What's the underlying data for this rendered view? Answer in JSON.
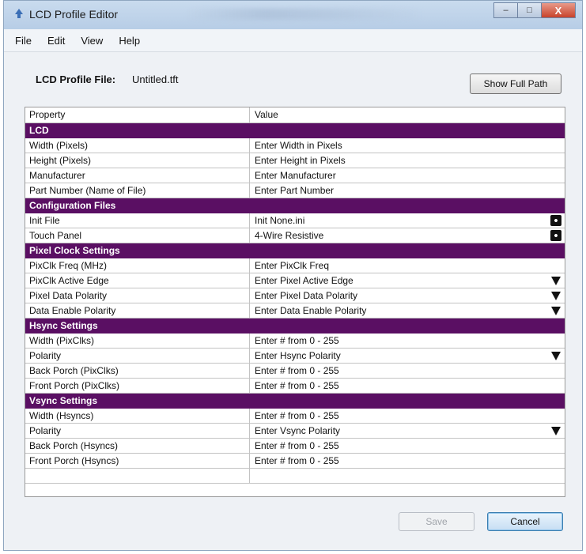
{
  "window": {
    "title": "LCD Profile Editor",
    "controls": {
      "minimize": "–",
      "maximize": "□",
      "close": "X"
    }
  },
  "menu": [
    "File",
    "Edit",
    "View",
    "Help"
  ],
  "profile": {
    "label": "LCD Profile File:",
    "value": "Untitled.tft",
    "full_path_button": "Show Full Path"
  },
  "grid": {
    "columns": [
      "Property",
      "Value"
    ],
    "rows": [
      {
        "type": "category",
        "label": "LCD"
      },
      {
        "type": "prop",
        "property": "Width (Pixels)",
        "value": "Enter Width in Pixels",
        "control": "none"
      },
      {
        "type": "prop",
        "property": "Height (Pixels)",
        "value": "Enter Height in Pixels",
        "control": "none"
      },
      {
        "type": "prop",
        "property": "Manufacturer",
        "value": "Enter Manufacturer",
        "control": "none"
      },
      {
        "type": "prop",
        "property": "Part Number (Name of File)",
        "value": "Enter Part Number",
        "control": "none"
      },
      {
        "type": "category",
        "label": "Configuration Files"
      },
      {
        "type": "prop",
        "property": "Init File",
        "value": "Init None.ini",
        "control": "browse"
      },
      {
        "type": "prop",
        "property": "Touch Panel",
        "value": "4-Wire Resistive",
        "control": "browse"
      },
      {
        "type": "category",
        "label": "Pixel Clock Settings"
      },
      {
        "type": "prop",
        "property": "PixClk Freq (MHz)",
        "value": "Enter PixClk Freq",
        "control": "none"
      },
      {
        "type": "prop",
        "property": "PixClk Active Edge",
        "value": "Enter Pixel Active Edge",
        "control": "dropdown"
      },
      {
        "type": "prop",
        "property": "Pixel Data Polarity",
        "value": "Enter Pixel Data Polarity",
        "control": "dropdown"
      },
      {
        "type": "prop",
        "property": "Data Enable Polarity",
        "value": "Enter Data Enable Polarity",
        "control": "dropdown"
      },
      {
        "type": "category",
        "label": "Hsync Settings"
      },
      {
        "type": "prop",
        "property": "Width (PixClks)",
        "value": "Enter # from 0 - 255",
        "control": "none"
      },
      {
        "type": "prop",
        "property": "Polarity",
        "value": "Enter Hsync Polarity",
        "control": "dropdown"
      },
      {
        "type": "prop",
        "property": "Back Porch (PixClks)",
        "value": "Enter # from 0 - 255",
        "control": "none"
      },
      {
        "type": "prop",
        "property": "Front Porch (PixClks)",
        "value": "Enter # from 0 - 255",
        "control": "none"
      },
      {
        "type": "category",
        "label": "Vsync Settings"
      },
      {
        "type": "prop",
        "property": "Width (Hsyncs)",
        "value": "Enter # from 0 - 255",
        "control": "none"
      },
      {
        "type": "prop",
        "property": "Polarity",
        "value": "Enter Vsync Polarity",
        "control": "dropdown"
      },
      {
        "type": "prop",
        "property": "Back Porch (Hsyncs)",
        "value": "Enter # from 0 - 255",
        "control": "none"
      },
      {
        "type": "prop",
        "property": "Front Porch (Hsyncs)",
        "value": "Enter # from 0 - 255",
        "control": "none"
      },
      {
        "type": "empty"
      }
    ]
  },
  "buttons": {
    "save": "Save",
    "cancel": "Cancel",
    "save_enabled": false
  },
  "colors": {
    "category_bg": "#5a0f63",
    "category_text": "#ffffff"
  }
}
